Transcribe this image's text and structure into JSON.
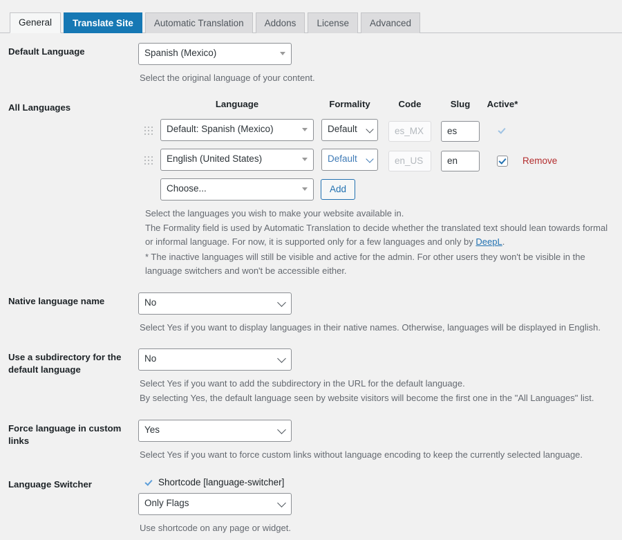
{
  "tabs": [
    {
      "label": "General",
      "state": "active"
    },
    {
      "label": "Translate Site",
      "state": "primary"
    },
    {
      "label": "Automatic Translation",
      "state": "normal"
    },
    {
      "label": "Addons",
      "state": "normal"
    },
    {
      "label": "License",
      "state": "normal"
    },
    {
      "label": "Advanced",
      "state": "normal"
    }
  ],
  "colors": {
    "primary_tab_bg": "#1678b4",
    "link": "#2271b1",
    "remove_link": "#b32d2e",
    "page_bg": "#f1f1f1",
    "check_blue": "#2271b1"
  },
  "default_language": {
    "label": "Default Language",
    "value": "Spanish (Mexico)",
    "description": "Select the original language of your content."
  },
  "all_languages": {
    "label": "All Languages",
    "headers": {
      "language": "Language",
      "formality": "Formality",
      "code": "Code",
      "slug": "Slug",
      "active": "Active*"
    },
    "rows": [
      {
        "language": "Default: Spanish (Mexico)",
        "formality": "Default",
        "formality_style": "muted",
        "code": "es_MX",
        "slug": "es",
        "active": true,
        "active_style": "faded",
        "remove_label": ""
      },
      {
        "language": "English (United States)",
        "formality": "Default",
        "formality_style": "blue",
        "code": "en_US",
        "slug": "en",
        "active": true,
        "active_style": "checkbox",
        "remove_label": "Remove"
      }
    ],
    "add_row": {
      "choose_placeholder": "Choose...",
      "add_label": "Add"
    },
    "description_line_1": "Select the languages you wish to make your website available in.",
    "description_line_2_part1": "The Formality field is used by Automatic Translation to decide whether the translated text should lean towards formal or informal language. For now, it is supported only for a few languages and only by ",
    "description_line_2_link": "DeepL",
    "description_line_2_part2": ".",
    "description_line_3": "* The inactive languages will still be visible and active for the admin. For other users they won't be visible in the language switchers and won't be accessible either."
  },
  "native_language_name": {
    "label": "Native language name",
    "value": "No",
    "description": "Select Yes if you want to display languages in their native names. Otherwise, languages will be displayed in English."
  },
  "subdirectory": {
    "label": "Use a subdirectory for the default language",
    "value": "No",
    "description_line_1": "Select Yes if you want to add the subdirectory in the URL for the default language.",
    "description_line_2": "By selecting Yes, the default language seen by website visitors will become the first one in the \"All Languages\" list."
  },
  "force_language": {
    "label": "Force language in custom links",
    "value": "Yes",
    "description": "Select Yes if you want to force custom links without language encoding to keep the currently selected language."
  },
  "language_switcher": {
    "label": "Language Switcher",
    "shortcode_label": "Shortcode [language-switcher]",
    "shortcode_checked": true,
    "display_value": "Only Flags",
    "description": "Use shortcode on any page or widget."
  }
}
